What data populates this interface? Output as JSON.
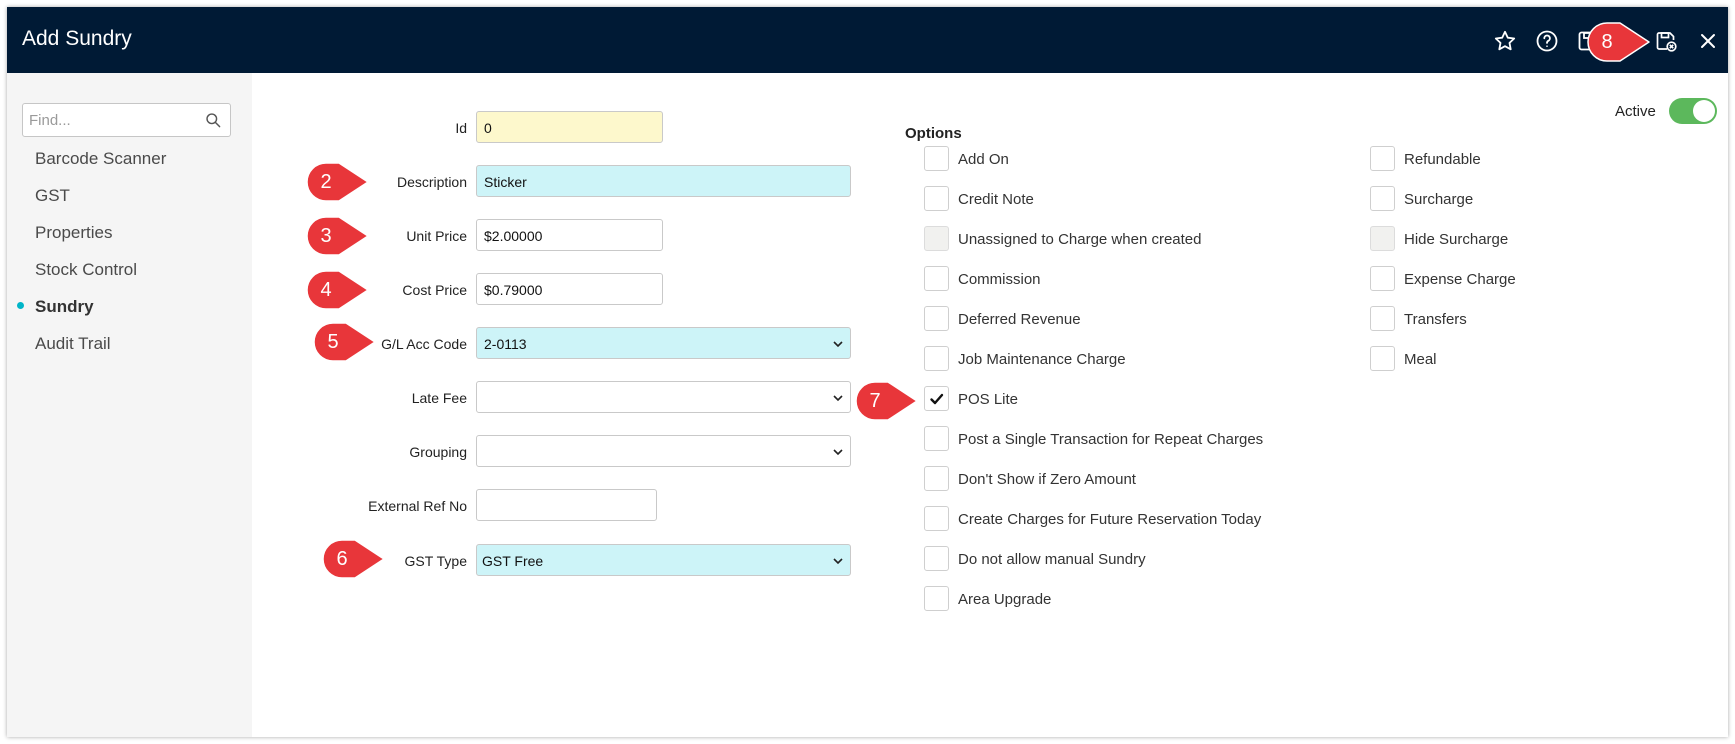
{
  "window": {
    "title": "Add Sundry",
    "toolbar_icons": [
      "star-icon",
      "help-icon",
      "save-icon",
      "save-close-icon",
      "close-icon"
    ]
  },
  "sidebar": {
    "search_placeholder": "Find...",
    "items": [
      {
        "label": "Barcode Scanner",
        "active": false
      },
      {
        "label": "GST",
        "active": false
      },
      {
        "label": "Properties",
        "active": false
      },
      {
        "label": "Stock Control",
        "active": false
      },
      {
        "label": "Sundry",
        "active": true
      },
      {
        "label": "Audit Trail",
        "active": false
      }
    ]
  },
  "form": {
    "id": {
      "label": "Id",
      "value": "0"
    },
    "description": {
      "label": "Description",
      "value": "Sticker"
    },
    "unit_price": {
      "label": "Unit Price",
      "value": "$2.00000"
    },
    "cost_price": {
      "label": "Cost Price",
      "value": "$0.79000"
    },
    "gl_acc_code": {
      "label": "G/L Acc Code",
      "value": "2-0113"
    },
    "late_fee": {
      "label": "Late Fee",
      "value": ""
    },
    "grouping": {
      "label": "Grouping",
      "value": ""
    },
    "external_ref": {
      "label": "External Ref No",
      "value": ""
    },
    "gst_type": {
      "label": "GST Type",
      "value": "GST Free"
    }
  },
  "active": {
    "label": "Active",
    "on": true
  },
  "options": {
    "title": "Options",
    "left": [
      {
        "label": "Add On",
        "checked": false,
        "disabled": false
      },
      {
        "label": "Credit Note",
        "checked": false,
        "disabled": false
      },
      {
        "label": "Unassigned to Charge when created",
        "checked": false,
        "disabled": true
      },
      {
        "label": "Commission",
        "checked": false,
        "disabled": false
      },
      {
        "label": "Deferred Revenue",
        "checked": false,
        "disabled": false
      },
      {
        "label": "Job Maintenance Charge",
        "checked": false,
        "disabled": false
      },
      {
        "label": "POS Lite",
        "checked": true,
        "disabled": false
      },
      {
        "label": "Post a Single Transaction for Repeat Charges",
        "checked": false,
        "disabled": false
      },
      {
        "label": "Don't Show if Zero Amount",
        "checked": false,
        "disabled": false
      },
      {
        "label": "Create Charges for Future Reservation Today",
        "checked": false,
        "disabled": false
      },
      {
        "label": "Do not allow manual Sundry",
        "checked": false,
        "disabled": false
      },
      {
        "label": "Area Upgrade",
        "checked": false,
        "disabled": false
      }
    ],
    "right": [
      {
        "label": "Refundable",
        "checked": false,
        "disabled": false
      },
      {
        "label": "Surcharge",
        "checked": false,
        "disabled": false
      },
      {
        "label": "Hide Surcharge",
        "checked": false,
        "disabled": true
      },
      {
        "label": "Expense Charge",
        "checked": false,
        "disabled": false
      },
      {
        "label": "Transfers",
        "checked": false,
        "disabled": false
      },
      {
        "label": "Meal",
        "checked": false,
        "disabled": false
      }
    ]
  },
  "callouts": [
    "2",
    "3",
    "4",
    "5",
    "6",
    "7",
    "8"
  ],
  "colors": {
    "titlebar": "#001a35",
    "callout": "#e8363a",
    "highlight": "#cdf4f8",
    "id_field": "#fdf8cc",
    "toggle_on": "#5cb85c",
    "active_dot": "#00b5c8"
  }
}
